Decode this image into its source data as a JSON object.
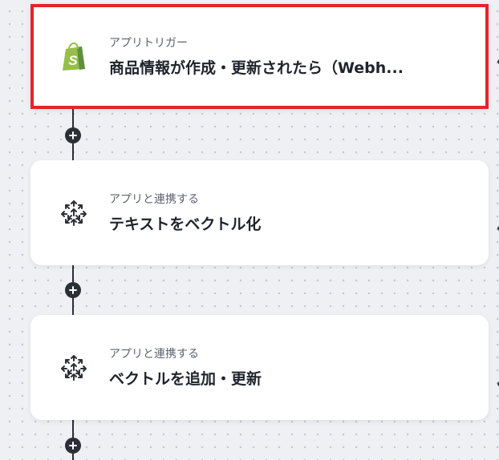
{
  "flow": {
    "steps": [
      {
        "subtitle": "アプリトリガー",
        "title": "商品情報が作成・更新されたら（Webh...",
        "icon": "shopify-icon",
        "selected": true
      },
      {
        "subtitle": "アプリと連携する",
        "title": "テキストをベクトル化",
        "icon": "pinecone-icon",
        "selected": false
      },
      {
        "subtitle": "アプリと連携する",
        "title": "ベクトルを追加・更新",
        "icon": "pinecone-icon",
        "selected": false
      }
    ],
    "colors": {
      "selected_border": "#e5242a",
      "connector": "#2b2f36",
      "shopify_green": "#95bf47",
      "shopify_dark": "#5e8e3e"
    }
  }
}
